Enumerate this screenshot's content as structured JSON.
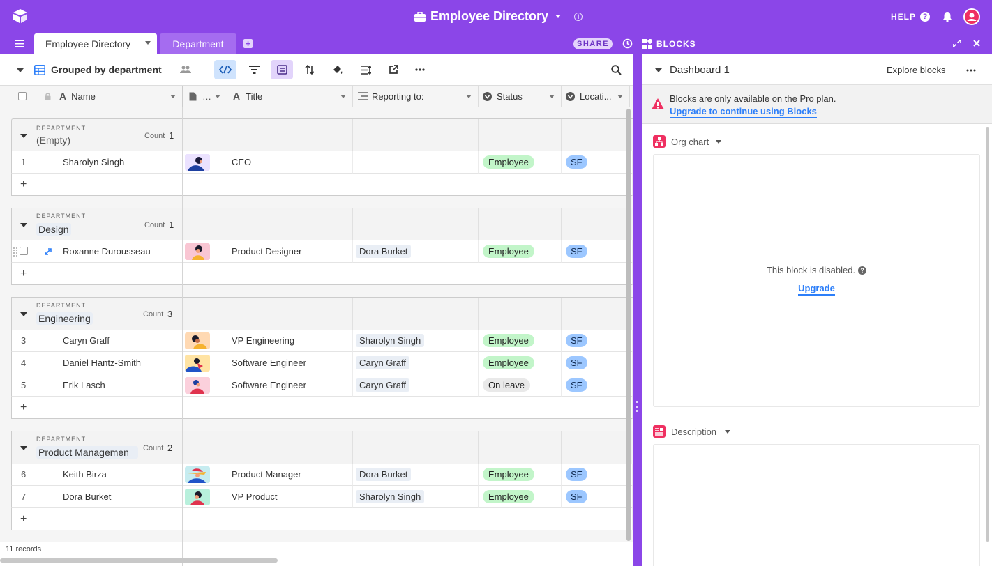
{
  "app": {
    "base_title": "Employee Directory",
    "help_label": "HELP"
  },
  "tabs": [
    {
      "label": "Employee Directory",
      "active": true
    },
    {
      "label": "Department",
      "active": false
    }
  ],
  "toolbar": {
    "share_label": "SHARE",
    "blocks_label": "BLOCKS",
    "view_name": "Grouped by department"
  },
  "columns": [
    "Name",
    "…",
    "Title",
    "Reporting to:",
    "Status",
    "Locati..."
  ],
  "group_label": "DEPARTMENT",
  "count_label": "Count",
  "groups": [
    {
      "name": "(Empty)",
      "count": "1",
      "rows": [
        {
          "num": "1",
          "name": "Sharolyn Singh",
          "title": "CEO",
          "reporting": "",
          "status": "Employee",
          "location": "SF"
        }
      ]
    },
    {
      "name": "Design",
      "count": "1",
      "rows": [
        {
          "num": "",
          "name": "Roxanne Durousseau",
          "title": "Product Designer",
          "reporting": "Dora Burket",
          "status": "Employee",
          "location": "SF"
        }
      ]
    },
    {
      "name": "Engineering",
      "count": "3",
      "rows": [
        {
          "num": "3",
          "name": "Caryn Graff",
          "title": "VP Engineering",
          "reporting": "Sharolyn Singh",
          "status": "Employee",
          "location": "SF"
        },
        {
          "num": "4",
          "name": "Daniel Hantz-Smith",
          "title": "Software Engineer",
          "reporting": "Caryn Graff",
          "status": "Employee",
          "location": "SF"
        },
        {
          "num": "5",
          "name": "Erik Lasch",
          "title": "Software Engineer",
          "reporting": "Caryn Graff",
          "status": "On leave",
          "location": "SF"
        }
      ]
    },
    {
      "name": "Product Managemen",
      "count": "2",
      "rows": [
        {
          "num": "6",
          "name": "Keith Birza",
          "title": "Product Manager",
          "reporting": "Dora Burket",
          "status": "Employee",
          "location": "SF"
        },
        {
          "num": "7",
          "name": "Dora Burket",
          "title": "VP Product",
          "reporting": "Sharolyn Singh",
          "status": "Employee",
          "location": "SF"
        }
      ]
    }
  ],
  "footer": {
    "records": "11 records"
  },
  "panel": {
    "dashboard_name": "Dashboard 1",
    "explore_label": "Explore blocks",
    "notice_text": "Blocks are only available on the Pro plan.",
    "notice_link": "Upgrade to continue using Blocks",
    "block1_title": "Org chart",
    "disabled_text": "This block is disabled.",
    "upgrade_label": "Upgrade",
    "block2_title": "Description"
  },
  "colors": {
    "brand": "#8b46e8",
    "employee": "#c2f5c9",
    "on_leave": "#e9e9e9",
    "location": "#9cc7ff",
    "link": "#2d7ff9",
    "warning": "#ef3061"
  },
  "icons": [
    "logo-icon",
    "menu-icon",
    "add-table-icon",
    "history-icon",
    "blocks-icon",
    "expand-icon",
    "close-icon",
    "help-icon",
    "bell-icon",
    "user-avatar-icon",
    "grid-view-icon",
    "collaborators-icon",
    "hide-fields-icon",
    "filter-icon",
    "group-icon",
    "sort-icon",
    "color-icon",
    "row-height-icon",
    "share-view-icon",
    "more-icon",
    "search-icon",
    "warning-icon",
    "org-chart-icon",
    "description-icon"
  ]
}
